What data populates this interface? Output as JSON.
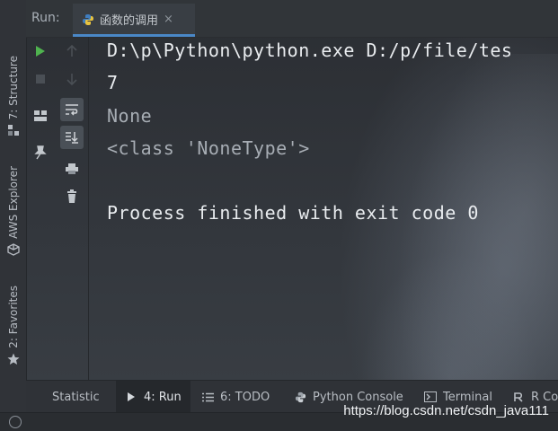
{
  "header": {
    "run_label": "Run:",
    "tab_title": "函数的调用",
    "tab_close": "×"
  },
  "left_strip": {
    "structure": "7: Structure",
    "aws": "AWS Explorer",
    "favorites": "2: Favorites"
  },
  "console": {
    "lines": [
      "D:\\p\\Python\\python.exe D:/p/file/tes",
      "7",
      "None",
      "<class 'NoneType'>",
      "",
      "Process finished with exit code 0"
    ]
  },
  "bottom": {
    "statistic": "Statistic",
    "run": "4: Run",
    "todo": "6: TODO",
    "python_console": "Python Console",
    "terminal": "Terminal",
    "r_console": "R Co"
  },
  "watermark": "https://blog.csdn.net/csdn_java111",
  "colors": {
    "accent": "#4a88c7",
    "run_green": "#4fb34f",
    "console_text": "#e9ecef"
  }
}
